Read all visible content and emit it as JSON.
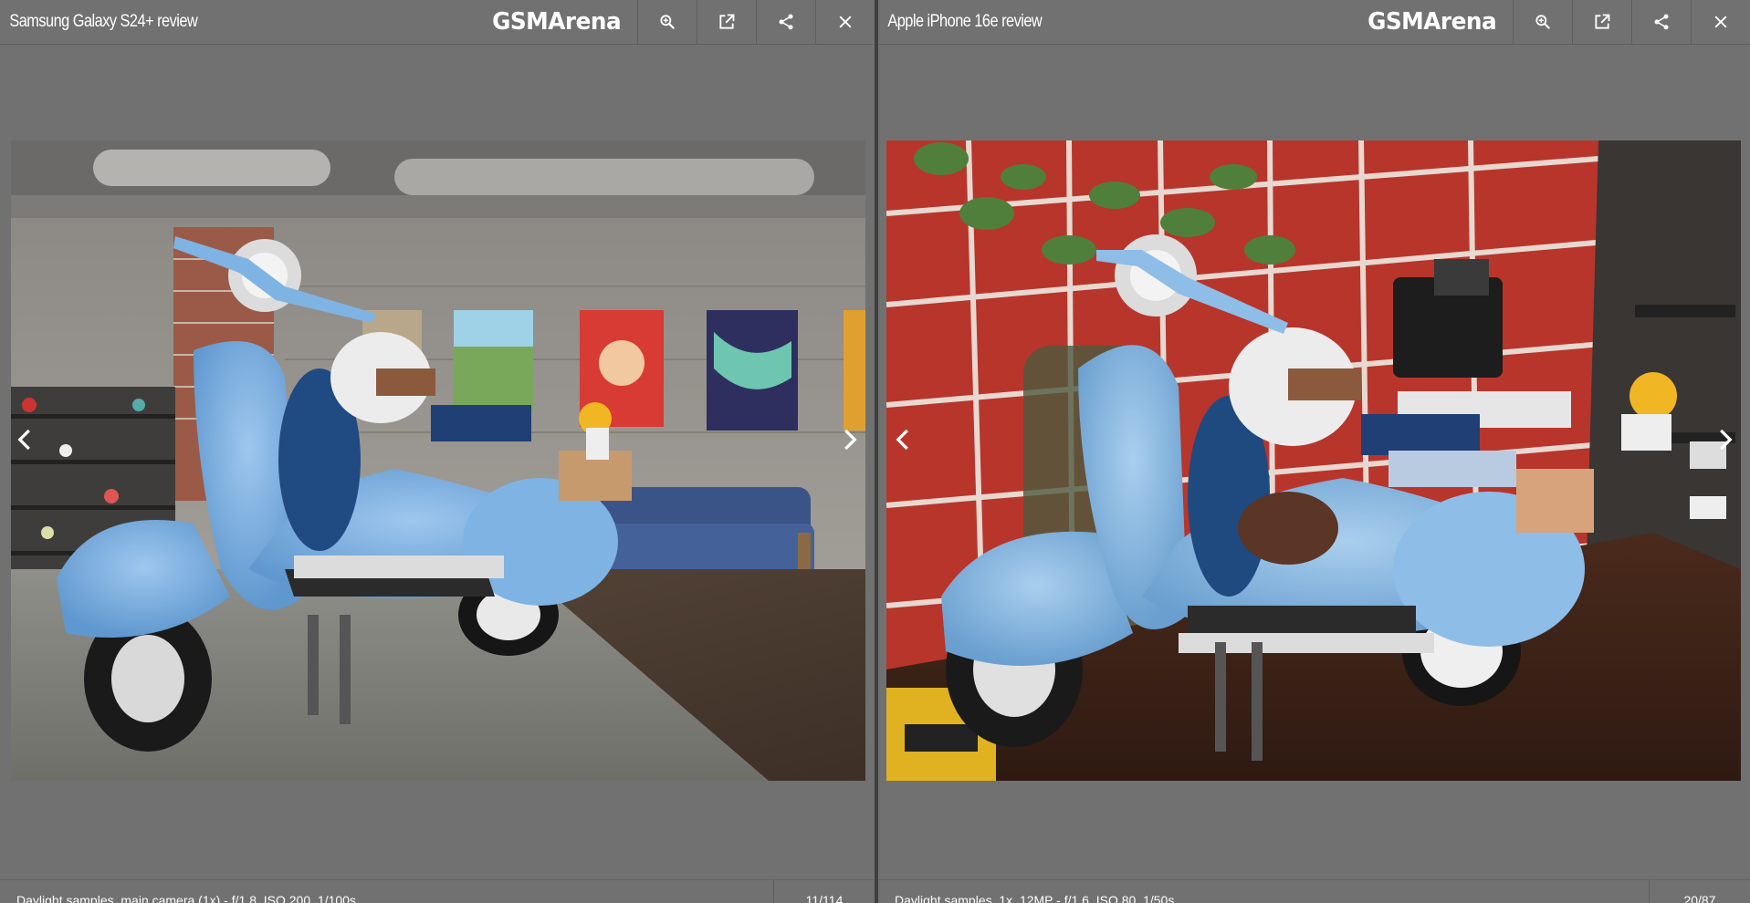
{
  "panes": [
    {
      "title": "Samsung Galaxy S24+ review",
      "logo": "GSMArena",
      "caption": "Daylight samples, main camera (1x) - f/1.8, ISO 200, 1/100s",
      "counter": "11/114"
    },
    {
      "title": "Apple iPhone 16e review",
      "logo": "GSMArena",
      "caption": "Daylight samples, 1x, 12MP - f/1.6, ISO 80, 1/50s",
      "counter": "20/87"
    }
  ],
  "icons": {
    "zoom": "zoom-icon",
    "open_external": "open-external-icon",
    "share": "share-icon",
    "close": "close-icon",
    "prev": "chevron-left-icon",
    "next": "chevron-right-icon"
  },
  "colors": {
    "background": "#717171",
    "divider": "#3f3f3f",
    "text": "#ffffff"
  }
}
